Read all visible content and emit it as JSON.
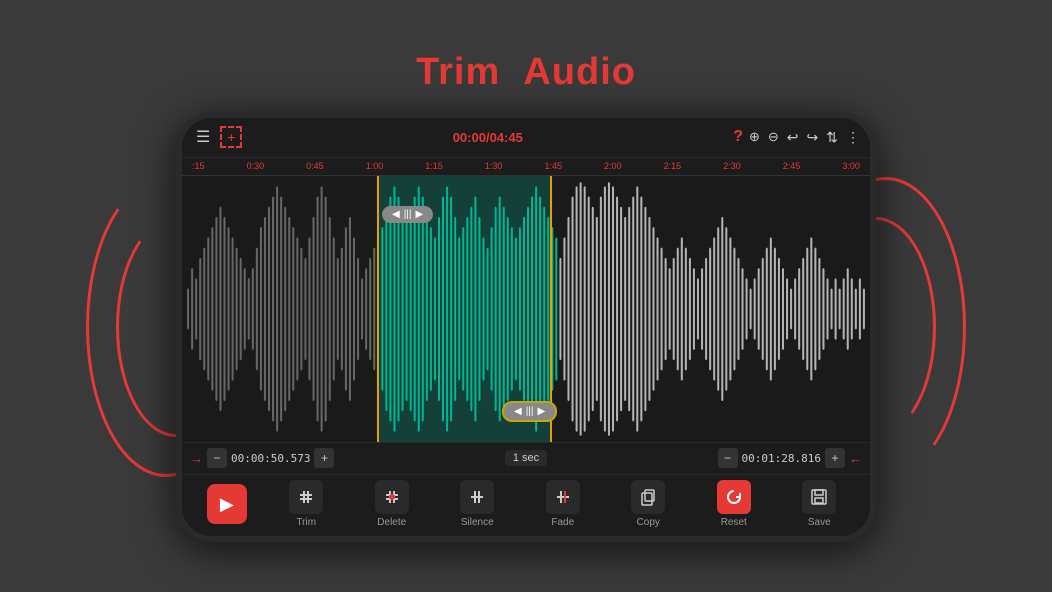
{
  "header": {
    "title_white": "Trim",
    "title_red": "Audio"
  },
  "topbar": {
    "menu_icon": "☰",
    "add_icon": "+",
    "time_current": "00:00",
    "time_separator": "/",
    "time_total": "04:45",
    "question_icon": "?",
    "zoom_in_icon": "🔍+",
    "zoom_out_icon": "🔍-",
    "undo_icon": "↩",
    "redo_icon": "↪",
    "swap_icon": "⇅",
    "more_icon": "⋮"
  },
  "ruler": {
    "labels": [
      ":15",
      "0:30",
      "0:45",
      "1:00",
      "1:15",
      "1:30",
      "1:45",
      "2:00",
      "2:15",
      "2:30",
      "2:45",
      "3:00"
    ]
  },
  "time_controls": {
    "left_arrow": "→",
    "right_arrow": "←",
    "start_time": "00:00:50.573",
    "end_time": "00:01:28.816",
    "step": "1 sec"
  },
  "toolbar": {
    "play_icon": "▶",
    "trim_label": "Trim",
    "delete_label": "Delete",
    "silence_label": "Silence",
    "fade_label": "Fade",
    "copy_label": "Copy",
    "reset_label": "Reset",
    "save_label": "Save"
  },
  "colors": {
    "accent_red": "#e53935",
    "selection_green": "#00c8a0",
    "handle_gold": "#c8a800"
  }
}
